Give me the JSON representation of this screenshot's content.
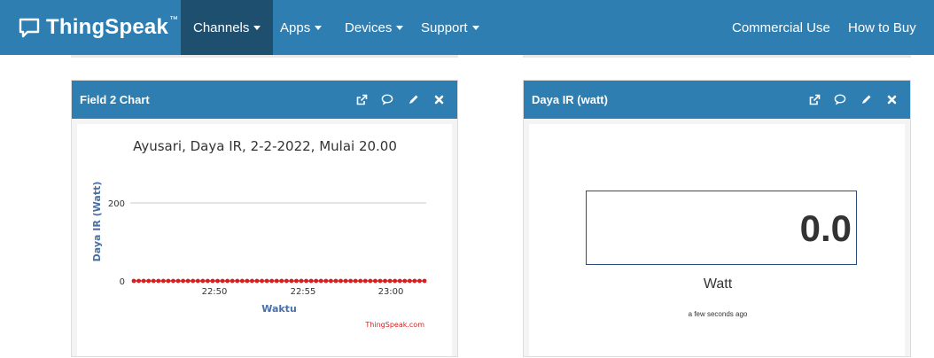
{
  "navbar": {
    "brand": "ThingSpeak",
    "brand_tm": "™",
    "items": [
      {
        "label": "Channels",
        "active": true
      },
      {
        "label": "Apps"
      },
      {
        "label": "Devices"
      },
      {
        "label": "Support"
      }
    ],
    "right_items": [
      {
        "label": "Commercial Use"
      },
      {
        "label": "How to Buy"
      }
    ]
  },
  "panels": {
    "chart": {
      "title": "Field 2 Chart"
    },
    "numeric": {
      "title": "Daya IR (watt)"
    }
  },
  "numeric_display": {
    "value": "0.0",
    "unit": "Watt",
    "updated": "a few seconds ago"
  },
  "colors": {
    "navbar": "#2f7eb1",
    "navbar_active": "#1f4f6e",
    "series": "#d62020",
    "axis_label": "#4a6fa5"
  },
  "icons": [
    "chat-bubble-icon",
    "external-link-icon",
    "comment-icon",
    "pencil-icon",
    "close-icon"
  ],
  "chart_data": {
    "type": "line",
    "title": "Ayusari, Daya IR, 2-2-2022, Mulai 20.00",
    "xlabel": "Waktu",
    "ylabel": "Daya IR (Watt)",
    "credit": "ThingSpeak.com",
    "x_ticks": [
      "22:50",
      "22:55",
      "23:00"
    ],
    "y_ticks": [
      "0",
      "200"
    ],
    "ylim": [
      0,
      200
    ],
    "grid": true,
    "series": [
      {
        "color": "#d62020",
        "values": [
          0,
          0,
          0,
          0,
          0,
          0,
          0,
          0,
          0,
          0,
          0,
          0,
          0,
          0,
          0,
          0,
          0,
          0,
          0,
          0,
          0,
          0,
          0,
          0,
          0,
          0,
          0,
          0,
          0,
          0,
          0,
          0,
          0,
          0,
          0,
          0,
          0,
          0,
          0,
          0,
          0,
          0,
          0,
          0,
          0,
          0,
          0,
          0,
          0,
          0,
          0,
          0,
          0,
          0,
          0,
          0,
          0,
          0,
          0,
          0
        ]
      }
    ]
  }
}
